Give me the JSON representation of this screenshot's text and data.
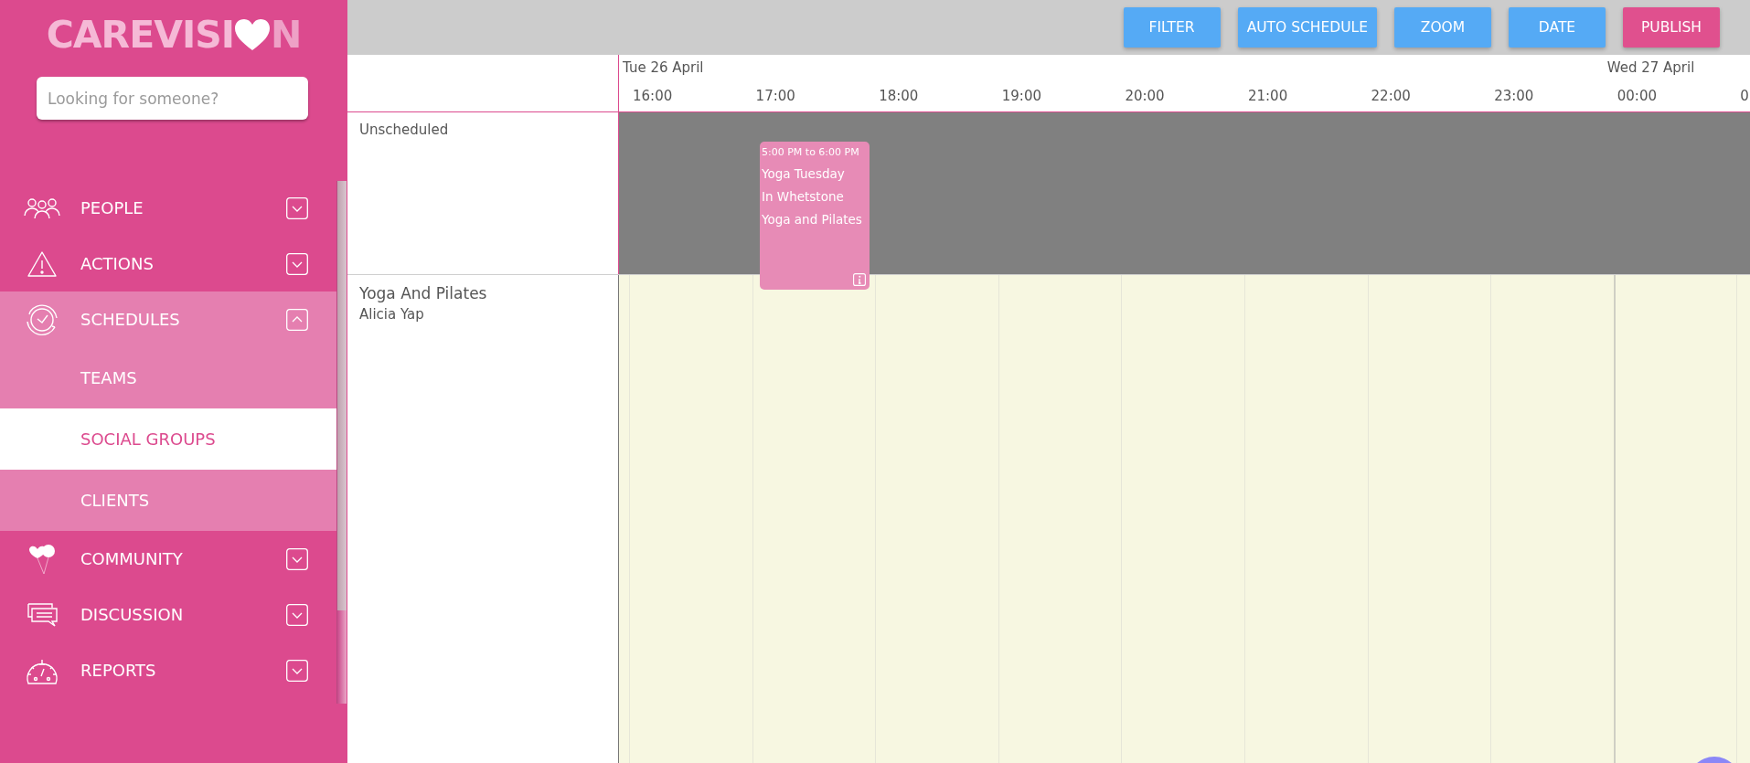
{
  "logo": {
    "text_before_heart": "CAREVISI",
    "text_after_heart": "N"
  },
  "search": {
    "placeholder": "Looking for someone?"
  },
  "nav": [
    {
      "label": "PEOPLE",
      "kind": "people",
      "expanded": false
    },
    {
      "label": "ACTIONS",
      "kind": "actions",
      "expanded": false
    },
    {
      "label": "SCHEDULES",
      "kind": "schedules",
      "expanded": true,
      "children": [
        {
          "label": "TEAMS",
          "selected": false
        },
        {
          "label": "SOCIAL GROUPS",
          "selected": true
        },
        {
          "label": "CLIENTS",
          "selected": false
        }
      ]
    },
    {
      "label": "COMMUNITY",
      "kind": "community",
      "expanded": false
    },
    {
      "label": "DISCUSSION",
      "kind": "discussion",
      "expanded": false
    },
    {
      "label": "REPORTS",
      "kind": "reports",
      "expanded": false
    }
  ],
  "toolbar": [
    {
      "label": "FILTER",
      "kind": "default"
    },
    {
      "label": "AUTO SCHEDULE",
      "kind": "default"
    },
    {
      "label": "ZOOM",
      "kind": "default"
    },
    {
      "label": "DATE",
      "kind": "default"
    },
    {
      "label": "PUBLISH",
      "kind": "publish"
    }
  ],
  "timeline": {
    "columns": [
      {
        "date": "Tue 26 April",
        "time": "16:00"
      },
      {
        "time": "17:00"
      },
      {
        "time": "18:00"
      },
      {
        "time": "19:00"
      },
      {
        "time": "20:00"
      },
      {
        "time": "21:00"
      },
      {
        "time": "22:00"
      },
      {
        "time": "23:00"
      },
      {
        "date": "Wed 27 April",
        "time": "00:00"
      },
      {
        "time": "0"
      }
    ]
  },
  "rows": [
    {
      "kind": "unscheduled",
      "label": "Unscheduled",
      "events": [
        {
          "time": "5:00 PM to 6:00 PM",
          "title": "Yoga Tuesday",
          "location": "In Whetstone",
          "group": "Yoga and Pilates"
        }
      ]
    },
    {
      "kind": "group",
      "label": "Yoga And Pilates",
      "sublabel": "Alicia Yap"
    }
  ]
}
